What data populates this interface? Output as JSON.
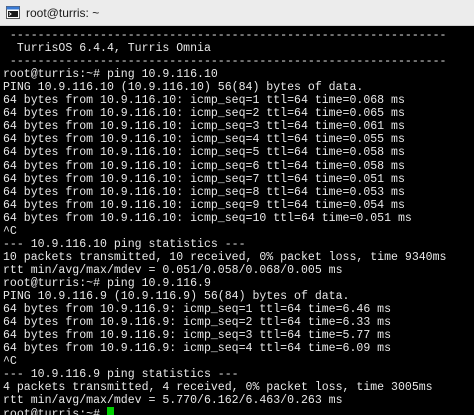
{
  "window": {
    "title": "root@turris: ~",
    "icon": "terminal-icon"
  },
  "colors": {
    "background": "#000000",
    "foreground": "#e8e8e8",
    "cursor": "#00d000",
    "titlebar": "#ececec"
  },
  "terminal": {
    "lines": [
      " ---------------------------------------------------------------",
      "  TurrisOS 6.4.4, Turris Omnia",
      " ---------------------------------------------------------------",
      "root@turris:~# ping 10.9.116.10",
      "PING 10.9.116.10 (10.9.116.10) 56(84) bytes of data.",
      "64 bytes from 10.9.116.10: icmp_seq=1 ttl=64 time=0.068 ms",
      "64 bytes from 10.9.116.10: icmp_seq=2 ttl=64 time=0.065 ms",
      "64 bytes from 10.9.116.10: icmp_seq=3 ttl=64 time=0.061 ms",
      "64 bytes from 10.9.116.10: icmp_seq=4 ttl=64 time=0.055 ms",
      "64 bytes from 10.9.116.10: icmp_seq=5 ttl=64 time=0.058 ms",
      "64 bytes from 10.9.116.10: icmp_seq=6 ttl=64 time=0.058 ms",
      "64 bytes from 10.9.116.10: icmp_seq=7 ttl=64 time=0.051 ms",
      "64 bytes from 10.9.116.10: icmp_seq=8 ttl=64 time=0.053 ms",
      "64 bytes from 10.9.116.10: icmp_seq=9 ttl=64 time=0.054 ms",
      "64 bytes from 10.9.116.10: icmp_seq=10 ttl=64 time=0.051 ms",
      "^C",
      "--- 10.9.116.10 ping statistics ---",
      "10 packets transmitted, 10 received, 0% packet loss, time 9340ms",
      "rtt min/avg/max/mdev = 0.051/0.058/0.068/0.005 ms",
      "root@turris:~# ping 10.9.116.9",
      "PING 10.9.116.9 (10.9.116.9) 56(84) bytes of data.",
      "64 bytes from 10.9.116.9: icmp_seq=1 ttl=64 time=6.46 ms",
      "64 bytes from 10.9.116.9: icmp_seq=2 ttl=64 time=6.33 ms",
      "64 bytes from 10.9.116.9: icmp_seq=3 ttl=64 time=5.77 ms",
      "64 bytes from 10.9.116.9: icmp_seq=4 ttl=64 time=6.09 ms",
      "^C",
      "--- 10.9.116.9 ping statistics ---",
      "4 packets transmitted, 4 received, 0% packet loss, time 3005ms",
      "rtt min/avg/max/mdev = 5.770/6.162/6.463/0.263 ms"
    ],
    "prompt": "root@turris:~# "
  }
}
